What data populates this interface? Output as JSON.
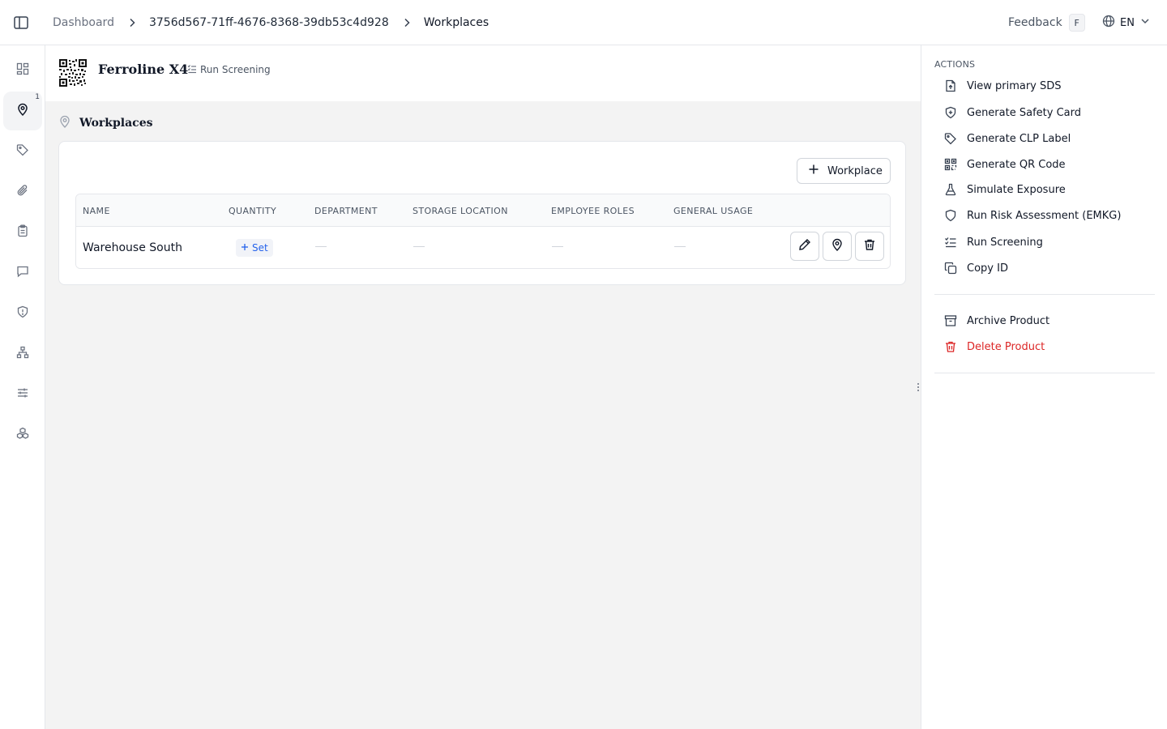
{
  "breadcrumb": {
    "items": [
      "Dashboard",
      "3756d567-71ff-4676-8368-39db53c4d928",
      "Workplaces"
    ]
  },
  "header": {
    "feedback_label": "Feedback",
    "feedback_shortcut": "F",
    "language": "EN"
  },
  "rail": {
    "items": [
      {
        "icon": "dashboard-icon"
      },
      {
        "icon": "map-pin-icon",
        "badge": "1",
        "active": true
      },
      {
        "icon": "tag-icon"
      },
      {
        "icon": "paperclip-icon"
      },
      {
        "icon": "clipboard-icon"
      },
      {
        "icon": "message-icon"
      },
      {
        "icon": "shield-alert-icon"
      },
      {
        "icon": "hierarchy-icon"
      },
      {
        "icon": "sliders-icon"
      },
      {
        "icon": "cubes-icon"
      }
    ]
  },
  "product": {
    "name": "Ferroline X4",
    "run_screening_label": "Run Screening"
  },
  "section": {
    "title": "Workplaces",
    "add_button_label": "Workplace"
  },
  "table": {
    "columns": [
      "NAME",
      "QUANTITY",
      "DEPARTMENT",
      "STORAGE LOCATION",
      "EMPLOYEE ROLES",
      "GENERAL USAGE"
    ],
    "rows": [
      {
        "name": "Warehouse South",
        "quantity_action": "Set",
        "department": "—",
        "storage_location": "—",
        "employee_roles": "—",
        "general_usage": "—"
      }
    ]
  },
  "actions_panel": {
    "heading": "ACTIONS",
    "items": [
      {
        "label": "View primary SDS",
        "icon": "file-upload-icon"
      },
      {
        "label": "Generate Safety Card",
        "icon": "shield-plus-icon"
      },
      {
        "label": "Generate CLP Label",
        "icon": "tag-icon"
      },
      {
        "label": "Generate QR Code",
        "icon": "qr-code-icon"
      },
      {
        "label": "Simulate Exposure",
        "icon": "flask-icon"
      },
      {
        "label": "Run Risk Assessment (EMKG)",
        "icon": "shield-icon"
      },
      {
        "label": "Run Screening",
        "icon": "list-checks-icon"
      },
      {
        "label": "Copy ID",
        "icon": "copy-icon"
      }
    ],
    "secondary": [
      {
        "label": "Archive Product",
        "icon": "archive-icon"
      },
      {
        "label": "Delete Product",
        "icon": "trash-icon",
        "danger": true
      }
    ]
  },
  "colors": {
    "danger": "#dc2626",
    "link": "#2563eb",
    "main_bg": "#f3f3f3"
  }
}
